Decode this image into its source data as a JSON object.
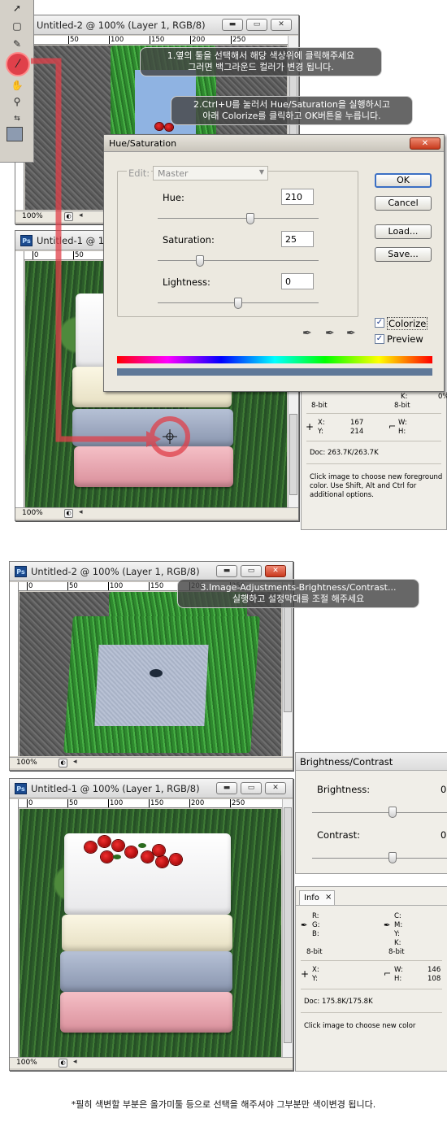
{
  "top_section": {
    "window_back": {
      "title": "Untitled-2 @ 100% (Layer 1, RGB/8)",
      "zoom": "100%"
    },
    "window_front": {
      "title": "Untitled-1 @ 10",
      "zoom": "100%"
    },
    "ruler_ticks_back": [
      "0",
      "50",
      "100",
      "150",
      "200",
      "250"
    ],
    "ruler_ticks_front": [
      "0",
      "50"
    ],
    "callout_1": {
      "line1": "1.옆의 툴을 선택해서 해당 색상위에 클릭해주세요",
      "line2": "그러면 백그라운드 컬러가 변경 됩니다."
    },
    "callout_2": {
      "line1": "2.Ctrl+U를 눌러서 Hue/Saturation을 실행하시고",
      "line2": "아래 Colorize를 클릭하고 OK버튼을 누릅니다."
    },
    "hue_dialog": {
      "title": "Hue/Saturation",
      "edit_label": "Edit:",
      "edit_value": "Master",
      "hue_label": "Hue:",
      "hue_value": "210",
      "hue_level": 0.58,
      "saturation_label": "Saturation:",
      "saturation_value": "25",
      "saturation_level": 0.25,
      "lightness_label": "Lightness:",
      "lightness_value": "0",
      "lightness_level": 0.5,
      "ok": "OK",
      "cancel": "Cancel",
      "load": "Load...",
      "save": "Save...",
      "colorize": "Colorize",
      "preview": "Preview",
      "colorize_checked": true,
      "preview_checked": true,
      "colorized_tint": "#5f7898"
    },
    "info_panel": {
      "k_label": "K:",
      "k_value": "0%",
      "bit_left": "8-bit",
      "bit_right": "8-bit",
      "x_label": "X:",
      "x_value": "167",
      "y_label": "Y:",
      "y_value": "214",
      "w_label": "W:",
      "h_label": "H:",
      "doc": "Doc: 263.7K/263.7K",
      "help_1": "Click image to choose new foreground",
      "help_2": "color.  Use Shift, Alt and Ctrl for",
      "help_3": "additional options."
    }
  },
  "bottom_section": {
    "window_back": {
      "title": "Untitled-2 @ 100% (Layer 1, RGB/8)",
      "zoom": "100%"
    },
    "window_front": {
      "title": "Untitled-1 @ 100% (Layer 1, RGB/8)",
      "zoom": "100%"
    },
    "ruler_ticks": [
      "0",
      "50",
      "100",
      "150",
      "200",
      "250"
    ],
    "callout_3": {
      "line1": "3.Image-Adjustments-Brightness/Contrast...",
      "line2": "실행하고 설정막대를 조절 해주세요"
    },
    "brightness_dialog": {
      "title": "Brightness/Contrast",
      "brightness_label": "Brightness:",
      "brightness_value": "0",
      "contrast_label": "Contrast:",
      "contrast_value": "0"
    },
    "info_panel": {
      "tab": "Info",
      "tab_close": "×",
      "r": "R:",
      "g": "G:",
      "b": "B:",
      "c": "C:",
      "m": "M:",
      "y": "Y:",
      "k": "K:",
      "bit_left": "8-bit",
      "bit_right": "8-bit",
      "x": "X:",
      "y2": "Y:",
      "w": "W:",
      "w_value": "146",
      "h": "H:",
      "h_value": "108",
      "doc": "Doc: 175.8K/175.8K",
      "help": "Click image to choose new color"
    }
  },
  "footer_note": "*필히 색변할 부분은 올가미툴 등으로 선택을 해주셔야 그부분만 색이변경 됩니다.",
  "colors": {
    "accent_red": "#e0404a",
    "window_gray": "#d4d0c8"
  }
}
